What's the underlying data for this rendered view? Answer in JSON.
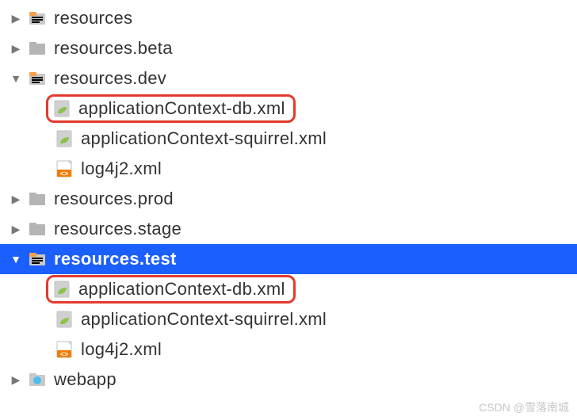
{
  "tree": {
    "resources": "resources",
    "resourcesBeta": "resources.beta",
    "resourcesDev": "resources.dev",
    "dev_appDb": "applicationContext-db.xml",
    "dev_appSquirrel": "applicationContext-squirrel.xml",
    "dev_log4j2": "log4j2.xml",
    "resourcesProd": "resources.prod",
    "resourcesStage": "resources.stage",
    "resourcesTest": "resources.test",
    "test_appDb": "applicationContext-db.xml",
    "test_appSquirrel": "applicationContext-squirrel.xml",
    "test_log4j2": "log4j2.xml",
    "webapp": "webapp"
  },
  "watermark": "CSDN @雪落南城"
}
